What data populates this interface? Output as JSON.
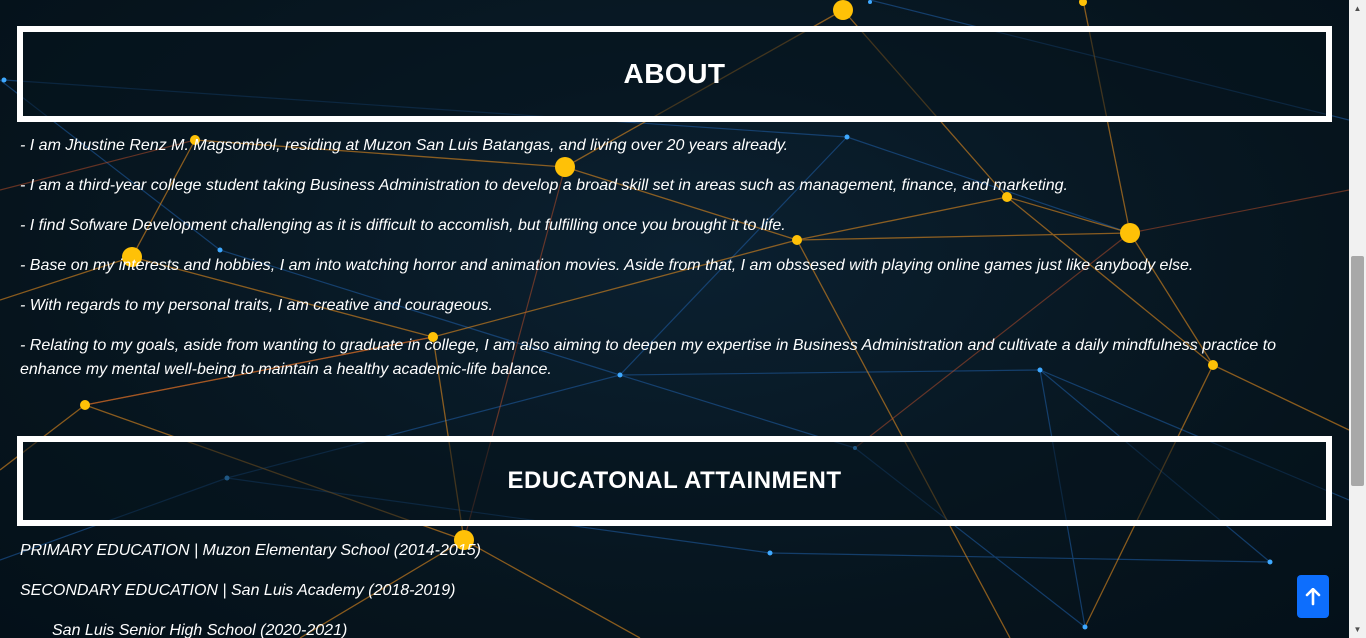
{
  "about": {
    "title": "ABOUT",
    "paragraphs": [
      "- I am Jhustine Renz M. Magsombol, residing at Muzon San Luis Batangas, and living over 20 years already.",
      "- I am a third-year college student taking Business Administration to develop a broad skill set in areas such as management, finance, and marketing.",
      "- I find Sofware Development challenging as it is difficult to accomlish, but fulfilling once you brought it to life.",
      "- Base on my interests and hobbies, I am into watching horror and animation movies. Aside from that, I am obssesed with playing online games just like anybody else.",
      "- With regards to my personal traits, I am creative and courageous.",
      "- Relating to my goals, aside from wanting to graduate in college, I am also aiming to deepen my expertise in Business Administration and cultivate a daily mindfulness practice to enhance my mental well-being to maintain a healthy academic-life balance."
    ]
  },
  "education": {
    "title": "EDUCATONAL ATTAINMENT",
    "entries": [
      "PRIMARY EDUCATION | Muzon Elementary School (2014-2015)",
      "SECONDARY EDUCATION | San Luis Academy (2018-2019)",
      "San Luis Senior High School (2020-2021)"
    ]
  },
  "back_to_top": {
    "icon": "arrow-up-icon",
    "color": "#0d6efd"
  },
  "theme": {
    "background": "#071721",
    "node_color": "#ffc107",
    "line_orange": "#e08a1e",
    "line_blue": "#1f5fa8"
  }
}
